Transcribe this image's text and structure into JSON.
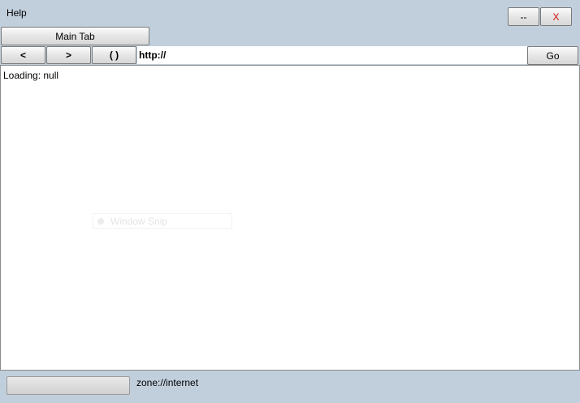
{
  "menu": {
    "help_label": "Help"
  },
  "window_controls": {
    "minimize_label": "--",
    "close_label": "X"
  },
  "tabs": [
    {
      "label": "Main Tab"
    }
  ],
  "nav": {
    "back_label": "<",
    "forward_label": ">",
    "reload_label": "( )",
    "url_value": "http://",
    "go_label": "Go"
  },
  "content": {
    "loading_text": "Loading: null",
    "ghost_text": "Window Snip"
  },
  "status": {
    "zone_text": "zone://internet",
    "progress": 0
  }
}
